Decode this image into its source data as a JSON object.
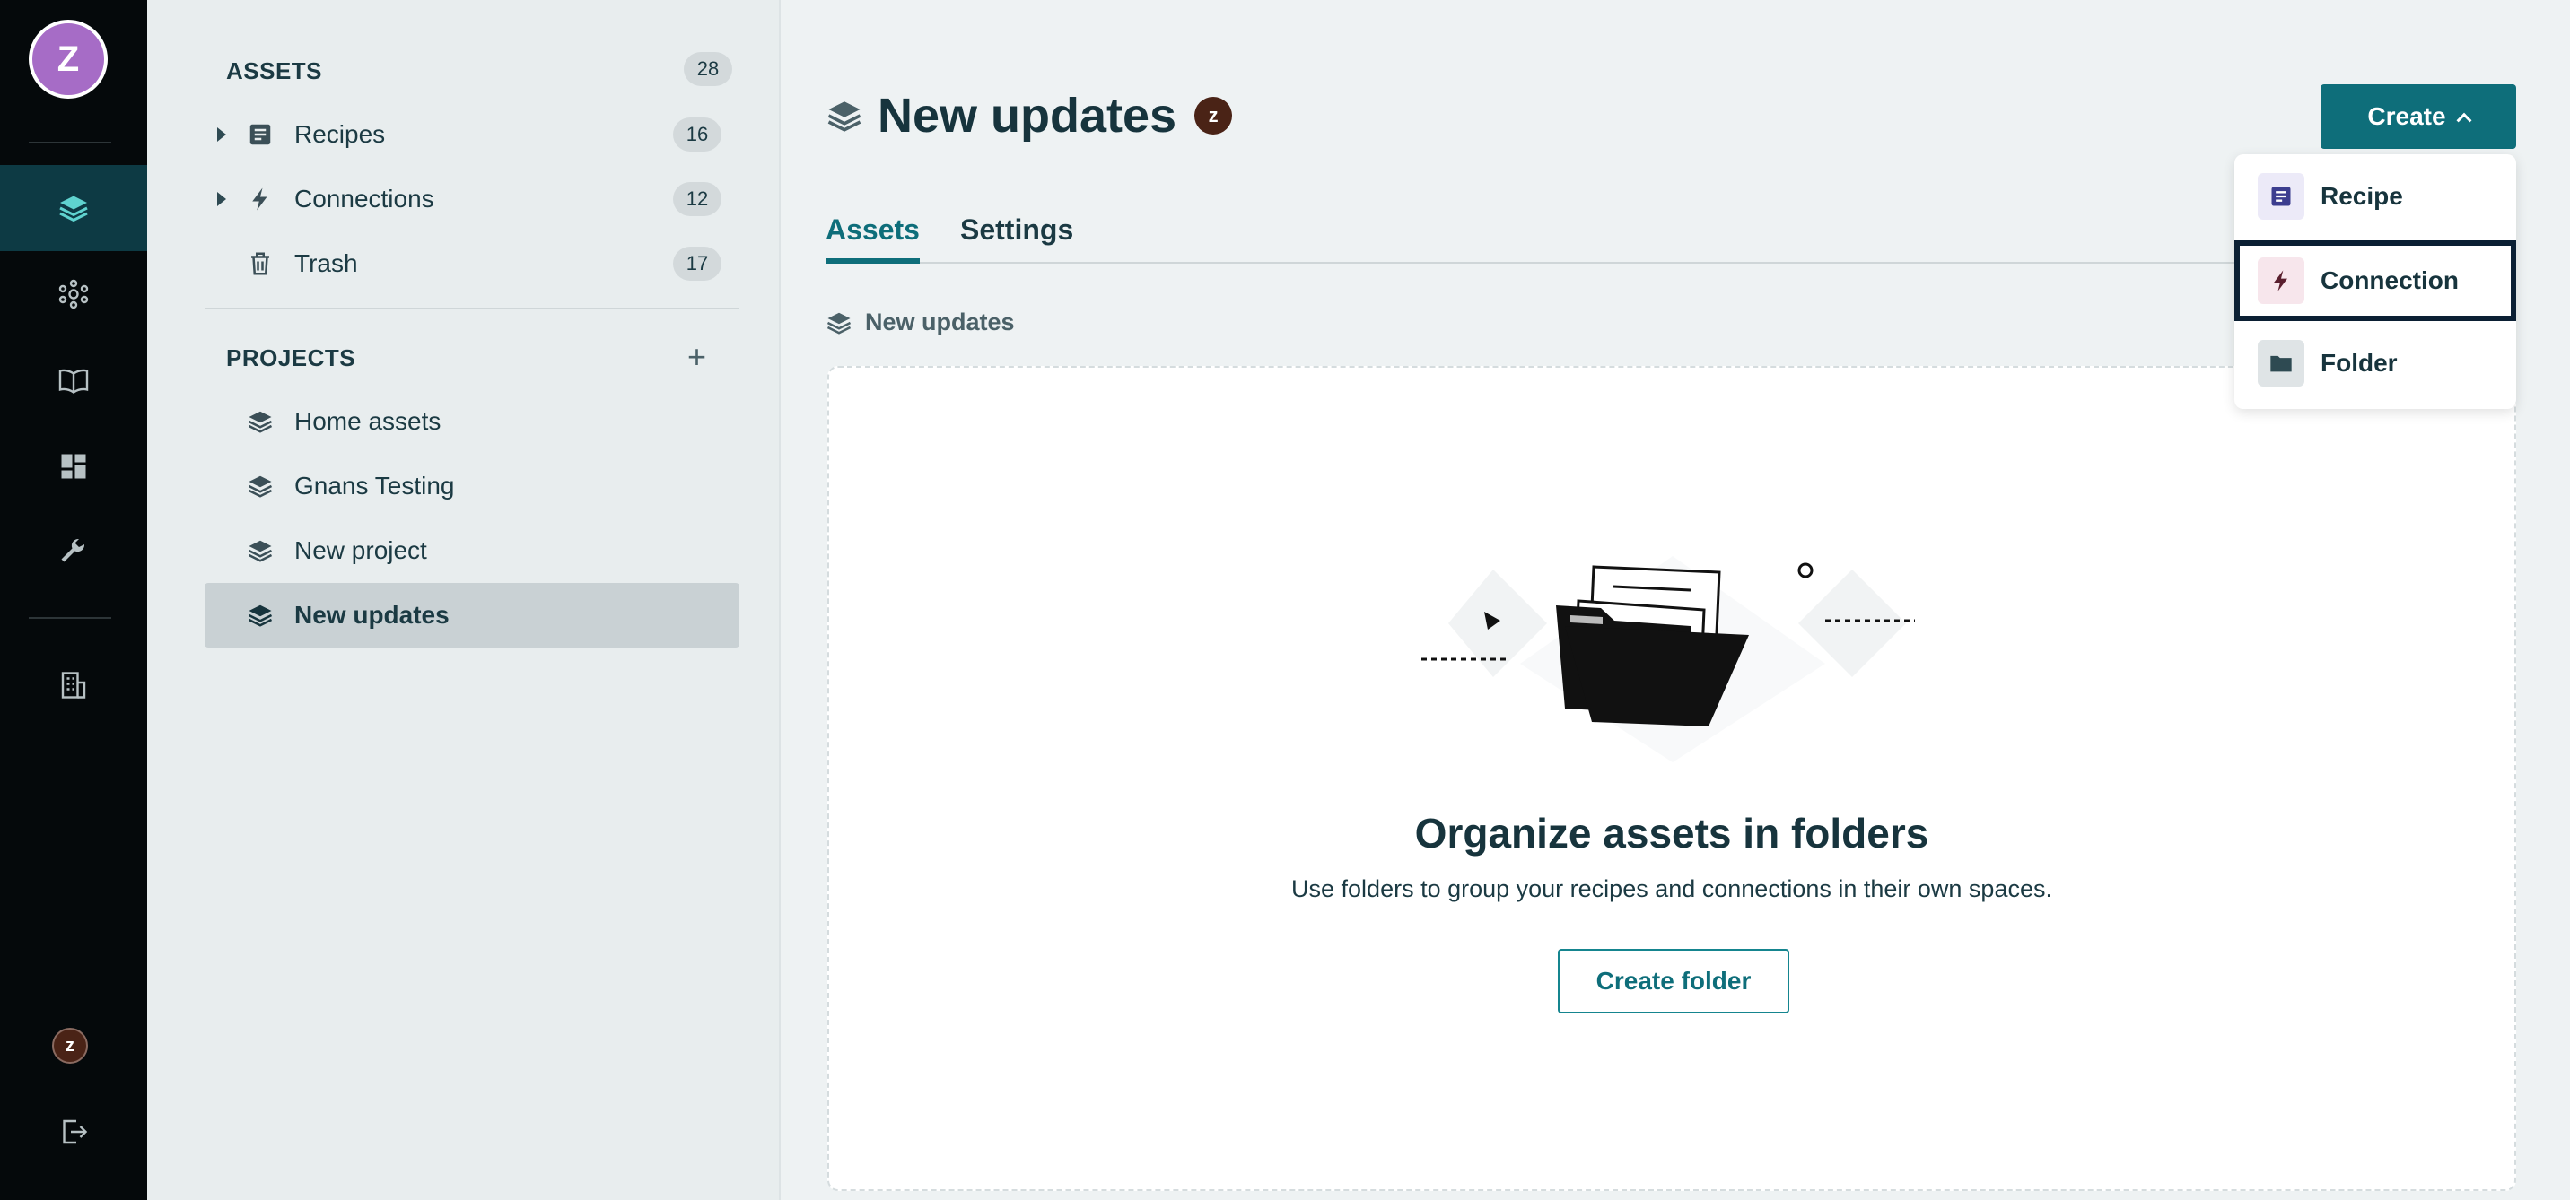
{
  "rail": {
    "avatar_initial": "Z",
    "user_initial": "z",
    "items": [
      "layers-icon",
      "hub-icon",
      "book-icon",
      "dashboard-icon",
      "wrench-icon",
      "building-icon"
    ]
  },
  "sidebar": {
    "assets_heading": "ASSETS",
    "assets_count": "28",
    "assets": [
      {
        "label": "Recipes",
        "count": "16",
        "icon": "recipe-icon"
      },
      {
        "label": "Connections",
        "count": "12",
        "icon": "bolt-icon"
      },
      {
        "label": "Trash",
        "count": "17",
        "icon": "trash-icon"
      }
    ],
    "projects_heading": "PROJECTS",
    "add_label": "+",
    "projects": [
      {
        "label": "Home assets"
      },
      {
        "label": "Gnans Testing"
      },
      {
        "label": "New project"
      },
      {
        "label": "New updates",
        "selected": true
      }
    ]
  },
  "main": {
    "title": "New updates",
    "owner_initial": "z",
    "create_label": "Create",
    "tabs": [
      {
        "label": "Assets",
        "active": true
      },
      {
        "label": "Settings"
      }
    ],
    "breadcrumb": "New updates",
    "empty": {
      "title": "Organize assets in folders",
      "description": "Use folders to group your recipes and connections in their own spaces.",
      "button": "Create folder"
    }
  },
  "dropdown": {
    "items": [
      {
        "label": "Recipe",
        "icon": "recipe-icon"
      },
      {
        "label": "Connection",
        "icon": "bolt-icon",
        "focused": true
      },
      {
        "label": "Folder",
        "icon": "folder-icon"
      }
    ]
  },
  "colors": {
    "rail_bg": "#05090b",
    "accent": "#0e6e7a",
    "sidebar_bg": "#e8edee",
    "selected_bg": "#c9d1d4"
  }
}
